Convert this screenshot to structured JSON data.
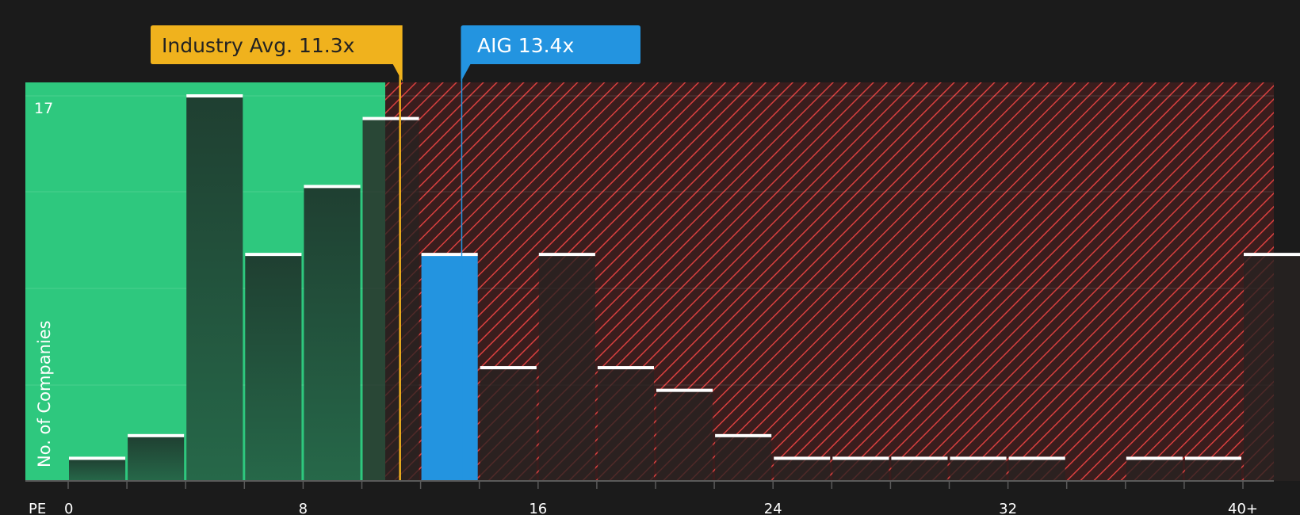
{
  "chart_data": {
    "type": "bar",
    "xlabel": "PE",
    "ylabel": "No. of Companies",
    "y_tick_label": "17",
    "ylim": [
      0,
      18
    ],
    "bin_width": 2,
    "x_ticks": [
      {
        "value": 0,
        "label": "0"
      },
      {
        "value": 8,
        "label": "8"
      },
      {
        "value": 16,
        "label": "16"
      },
      {
        "value": 24,
        "label": "24"
      },
      {
        "value": 32,
        "label": "32"
      },
      {
        "value": 40,
        "label": "40+"
      }
    ],
    "bins": [
      {
        "x0": 0,
        "count": 1
      },
      {
        "x0": 2,
        "count": 2
      },
      {
        "x0": 4,
        "count": 17
      },
      {
        "x0": 6,
        "count": 10
      },
      {
        "x0": 8,
        "count": 13
      },
      {
        "x0": 10,
        "count": 16
      },
      {
        "x0": 12,
        "count": 10,
        "highlight": true
      },
      {
        "x0": 14,
        "count": 5
      },
      {
        "x0": 16,
        "count": 10
      },
      {
        "x0": 18,
        "count": 5
      },
      {
        "x0": 20,
        "count": 4
      },
      {
        "x0": 22,
        "count": 2
      },
      {
        "x0": 24,
        "count": 1
      },
      {
        "x0": 26,
        "count": 1
      },
      {
        "x0": 28,
        "count": 1
      },
      {
        "x0": 30,
        "count": 1
      },
      {
        "x0": 32,
        "count": 1
      },
      {
        "x0": 34,
        "count": 0
      },
      {
        "x0": 36,
        "count": 1
      },
      {
        "x0": 38,
        "count": 1
      },
      {
        "x0": 40,
        "count": 10
      }
    ],
    "industry_avg": {
      "value": 11.3,
      "label": "Industry Avg. 11.3x"
    },
    "company": {
      "value": 13.4,
      "label": "AIG 13.4x"
    },
    "colors": {
      "background": "#1b1b1b",
      "undervalued": "#2ec87e",
      "overvalued": "#8b2f2f",
      "hatch": "#d9403f",
      "industry": "#f0b21d",
      "company": "#2394e0",
      "bar_green": "#224a37",
      "bar_red": "#3a2624"
    }
  }
}
